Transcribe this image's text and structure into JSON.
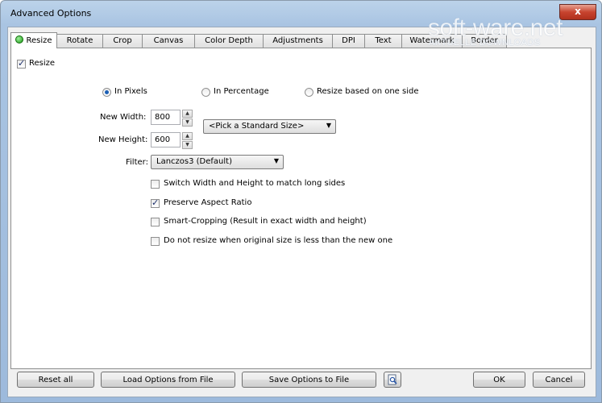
{
  "window": {
    "title": "Advanced Options",
    "close_symbol": "x"
  },
  "watermark": {
    "main": "soft-ware.net",
    "sub": "AKTUELLE DOWNLOADS"
  },
  "tabs": [
    {
      "label": "Resize",
      "active": true,
      "status_color": "#1d9b17"
    },
    {
      "label": "Rotate"
    },
    {
      "label": "Crop"
    },
    {
      "label": "Canvas"
    },
    {
      "label": "Color Depth"
    },
    {
      "label": "Adjustments"
    },
    {
      "label": "DPI"
    },
    {
      "label": "Text"
    },
    {
      "label": "Watermark"
    },
    {
      "label": "Border"
    }
  ],
  "resize": {
    "enable_label": "Resize",
    "enable_checked": true,
    "mode_options": [
      {
        "label": "In Pixels",
        "checked": true
      },
      {
        "label": "In Percentage",
        "checked": false
      },
      {
        "label": "Resize based on one side",
        "checked": false
      }
    ],
    "width_label": "New Width:",
    "width_value": "800",
    "height_label": "New Height:",
    "height_value": "600",
    "standard_size": "<Pick a Standard Size>",
    "filter_label": "Filter:",
    "filter_value": "Lanczos3 (Default)",
    "options": [
      {
        "label": "Switch Width and Height to match long sides",
        "checked": false
      },
      {
        "label": "Preserve Aspect Ratio",
        "checked": true
      },
      {
        "label": "Smart-Cropping (Result in exact width and height)",
        "checked": false
      },
      {
        "label": "Do not resize when original size is less than the new one",
        "checked": false
      }
    ]
  },
  "buttons": {
    "reset": "Reset all",
    "load": "Load Options from File",
    "save": "Save Options to File",
    "ok": "OK",
    "cancel": "Cancel"
  }
}
